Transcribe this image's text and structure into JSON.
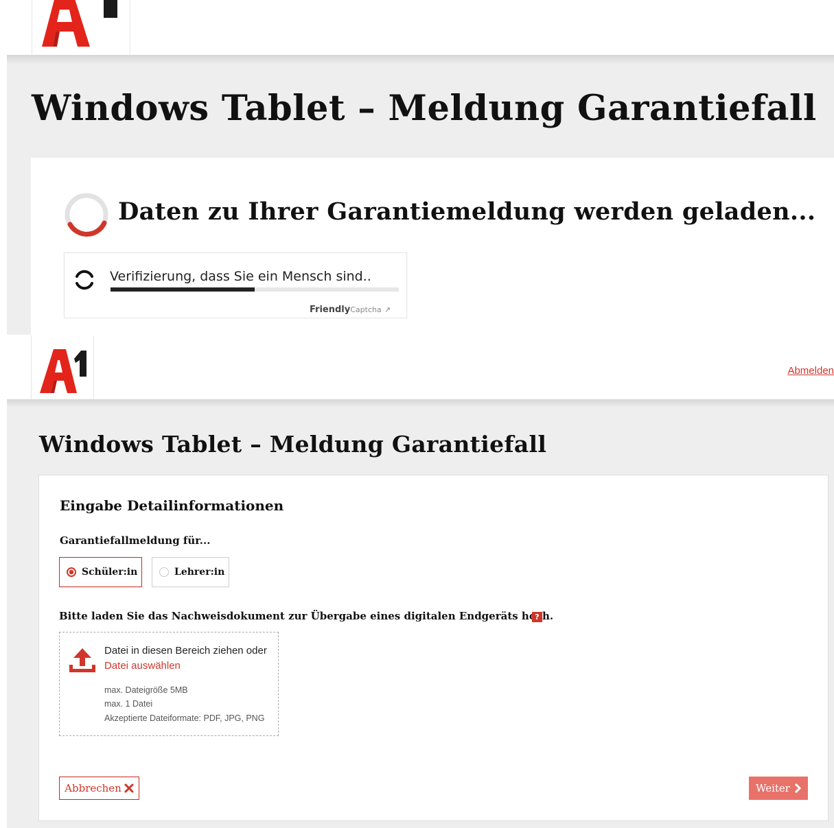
{
  "brand": {
    "logo_text": "A1",
    "colors": {
      "accent": "#d0362a",
      "accent_light": "#e8726a",
      "background": "#eeeeee"
    }
  },
  "loading_view": {
    "title": "Windows Tablet – Meldung Garantiefall",
    "loading_message": "Daten zu Ihrer Garantiemeldung werden geladen...",
    "captcha": {
      "status_text": "Verifizierung, dass Sie ein Mensch sind..",
      "progress": 0.5,
      "brand_bold": "Friendly",
      "brand_rest": "Captcha",
      "brand_icon": "external-link-icon"
    }
  },
  "form_view": {
    "header": {
      "logout_label": "Abmelden"
    },
    "title": "Windows Tablet – Meldung Garantiefall",
    "section_heading": "Eingabe Detailinformationen",
    "for_label": "Garantiefallmeldung für...",
    "options": [
      {
        "label": "Schüler:in",
        "selected": true
      },
      {
        "label": "Lehrer:in",
        "selected": false
      }
    ],
    "upload": {
      "label": "Bitte laden Sie das Nachweisdokument zur Übergabe eines digitalen Endgeräts hoch.",
      "help_icon_text": "?",
      "drop_text": "Datei in diesen Bereich ziehen oder",
      "choose_text": "Datei auswählen",
      "hints": [
        "max. Dateigröße 5MB",
        "max. 1 Datei",
        "Akzeptierte Dateiformate: PDF, JPG, PNG"
      ]
    },
    "cancel_label": "Abbrechen",
    "next_label": "Weiter"
  }
}
